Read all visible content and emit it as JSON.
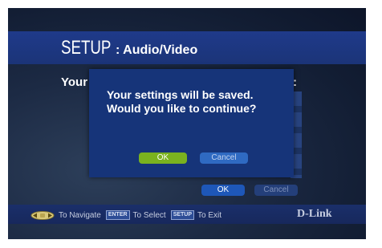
{
  "header": {
    "setup_label": "SETUP",
    "section_label": ": Audio/Video"
  },
  "background": {
    "partial_label": "Your",
    "colon": ":",
    "ok_label": "OK",
    "cancel_label": "Cancel"
  },
  "dialog": {
    "message_line1": "Your settings will be saved.",
    "message_line2": "Would you like to continue?",
    "ok_label": "OK",
    "cancel_label": "Cancel"
  },
  "footer": {
    "navigate_label": "To Navigate",
    "enter_key": "ENTER",
    "select_label": "To Select",
    "setup_key": "SETUP",
    "exit_label": "To Exit",
    "brand": "D-Link"
  },
  "colors": {
    "header_band": "#1f3a8a",
    "dialog_bg": "#163479",
    "ok_button": "#7ab21f",
    "cancel_button": "#2f6ac2"
  },
  "icons": [
    "navigate-arrows-icon"
  ]
}
